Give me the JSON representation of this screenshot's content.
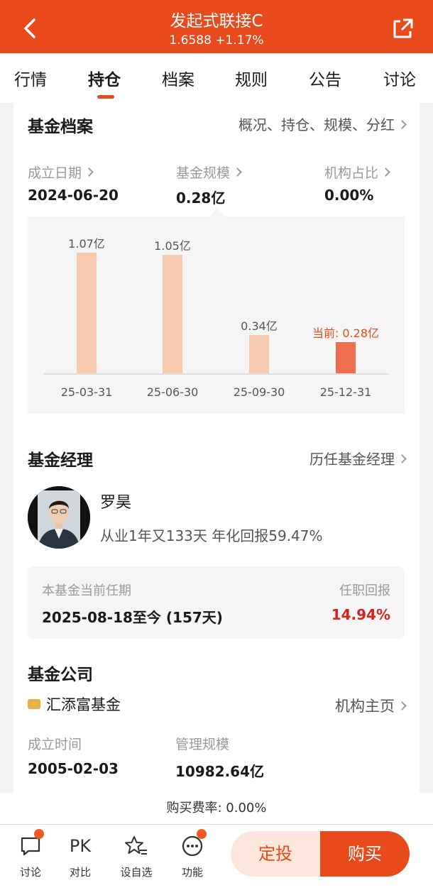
{
  "header": {
    "title": "发起式联接C",
    "subtitle": "1.6588 +1.17%"
  },
  "tabs": [
    "行情",
    "持仓",
    "档案",
    "规则",
    "公告",
    "讨论"
  ],
  "active_tab": "持仓",
  "profile": {
    "title": "基金档案",
    "link": "概况、持仓、规模、分红",
    "stats": [
      {
        "label": "成立日期",
        "value": "2024-06-20"
      },
      {
        "label": "基金规模",
        "value": "0.28亿"
      },
      {
        "label": "机构占比",
        "value": "0.00%"
      }
    ]
  },
  "chart_data": {
    "type": "bar",
    "categories": [
      "25-03-31",
      "25-06-30",
      "25-09-30",
      "25-12-31"
    ],
    "values": [
      1.07,
      1.05,
      0.34,
      0.28
    ],
    "value_labels": [
      "1.07亿",
      "1.05亿",
      "0.34亿",
      "当前: 0.28亿"
    ],
    "highlight_index": 3,
    "colors": {
      "bar": "#f7c9ad",
      "current": "#ed6f50"
    },
    "ylim": [
      0,
      1.07
    ]
  },
  "manager": {
    "title": "基金经理",
    "link": "历任基金经理",
    "name": "罗昊",
    "desc": "从业1年又133天 年化回报59.47%",
    "tenure_label": "本基金当前任期",
    "tenure_value": "2025-08-18至今 (157天)",
    "return_label": "任职回报",
    "return_value": "14.94%"
  },
  "company": {
    "title": "基金公司",
    "name": "汇添富基金",
    "link": "机构主页",
    "founded_label": "成立时间",
    "founded_value": "2005-02-03",
    "aum_label": "管理规模",
    "aum_value": "10982.64亿"
  },
  "fee": "购买费率: 0.00%",
  "bottom": {
    "items": [
      {
        "icon": "chat-icon",
        "label": "讨论"
      },
      {
        "icon": "pk-icon",
        "symbol": "PK",
        "label": "对比"
      },
      {
        "icon": "star-list-icon",
        "label": "设自选"
      },
      {
        "icon": "more-icon",
        "label": "功能"
      }
    ],
    "plan_label": "定投",
    "buy_label": "购买"
  },
  "colors": {
    "accent": "#e84a1c",
    "return_red": "#d8231d"
  }
}
